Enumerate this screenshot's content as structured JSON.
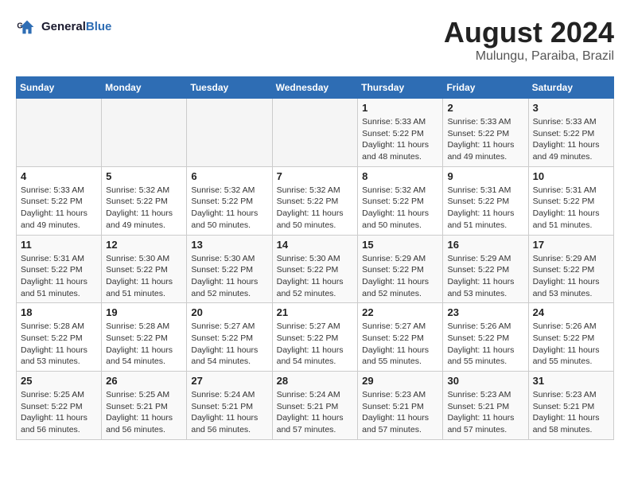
{
  "header": {
    "logo_line1": "General",
    "logo_line2": "Blue",
    "month_year": "August 2024",
    "location": "Mulungu, Paraiba, Brazil"
  },
  "days_of_week": [
    "Sunday",
    "Monday",
    "Tuesday",
    "Wednesday",
    "Thursday",
    "Friday",
    "Saturday"
  ],
  "weeks": [
    [
      {
        "day": "",
        "info": ""
      },
      {
        "day": "",
        "info": ""
      },
      {
        "day": "",
        "info": ""
      },
      {
        "day": "",
        "info": ""
      },
      {
        "day": "1",
        "info": "Sunrise: 5:33 AM\nSunset: 5:22 PM\nDaylight: 11 hours\nand 48 minutes."
      },
      {
        "day": "2",
        "info": "Sunrise: 5:33 AM\nSunset: 5:22 PM\nDaylight: 11 hours\nand 49 minutes."
      },
      {
        "day": "3",
        "info": "Sunrise: 5:33 AM\nSunset: 5:22 PM\nDaylight: 11 hours\nand 49 minutes."
      }
    ],
    [
      {
        "day": "4",
        "info": "Sunrise: 5:33 AM\nSunset: 5:22 PM\nDaylight: 11 hours\nand 49 minutes."
      },
      {
        "day": "5",
        "info": "Sunrise: 5:32 AM\nSunset: 5:22 PM\nDaylight: 11 hours\nand 49 minutes."
      },
      {
        "day": "6",
        "info": "Sunrise: 5:32 AM\nSunset: 5:22 PM\nDaylight: 11 hours\nand 50 minutes."
      },
      {
        "day": "7",
        "info": "Sunrise: 5:32 AM\nSunset: 5:22 PM\nDaylight: 11 hours\nand 50 minutes."
      },
      {
        "day": "8",
        "info": "Sunrise: 5:32 AM\nSunset: 5:22 PM\nDaylight: 11 hours\nand 50 minutes."
      },
      {
        "day": "9",
        "info": "Sunrise: 5:31 AM\nSunset: 5:22 PM\nDaylight: 11 hours\nand 51 minutes."
      },
      {
        "day": "10",
        "info": "Sunrise: 5:31 AM\nSunset: 5:22 PM\nDaylight: 11 hours\nand 51 minutes."
      }
    ],
    [
      {
        "day": "11",
        "info": "Sunrise: 5:31 AM\nSunset: 5:22 PM\nDaylight: 11 hours\nand 51 minutes."
      },
      {
        "day": "12",
        "info": "Sunrise: 5:30 AM\nSunset: 5:22 PM\nDaylight: 11 hours\nand 51 minutes."
      },
      {
        "day": "13",
        "info": "Sunrise: 5:30 AM\nSunset: 5:22 PM\nDaylight: 11 hours\nand 52 minutes."
      },
      {
        "day": "14",
        "info": "Sunrise: 5:30 AM\nSunset: 5:22 PM\nDaylight: 11 hours\nand 52 minutes."
      },
      {
        "day": "15",
        "info": "Sunrise: 5:29 AM\nSunset: 5:22 PM\nDaylight: 11 hours\nand 52 minutes."
      },
      {
        "day": "16",
        "info": "Sunrise: 5:29 AM\nSunset: 5:22 PM\nDaylight: 11 hours\nand 53 minutes."
      },
      {
        "day": "17",
        "info": "Sunrise: 5:29 AM\nSunset: 5:22 PM\nDaylight: 11 hours\nand 53 minutes."
      }
    ],
    [
      {
        "day": "18",
        "info": "Sunrise: 5:28 AM\nSunset: 5:22 PM\nDaylight: 11 hours\nand 53 minutes."
      },
      {
        "day": "19",
        "info": "Sunrise: 5:28 AM\nSunset: 5:22 PM\nDaylight: 11 hours\nand 54 minutes."
      },
      {
        "day": "20",
        "info": "Sunrise: 5:27 AM\nSunset: 5:22 PM\nDaylight: 11 hours\nand 54 minutes."
      },
      {
        "day": "21",
        "info": "Sunrise: 5:27 AM\nSunset: 5:22 PM\nDaylight: 11 hours\nand 54 minutes."
      },
      {
        "day": "22",
        "info": "Sunrise: 5:27 AM\nSunset: 5:22 PM\nDaylight: 11 hours\nand 55 minutes."
      },
      {
        "day": "23",
        "info": "Sunrise: 5:26 AM\nSunset: 5:22 PM\nDaylight: 11 hours\nand 55 minutes."
      },
      {
        "day": "24",
        "info": "Sunrise: 5:26 AM\nSunset: 5:22 PM\nDaylight: 11 hours\nand 55 minutes."
      }
    ],
    [
      {
        "day": "25",
        "info": "Sunrise: 5:25 AM\nSunset: 5:22 PM\nDaylight: 11 hours\nand 56 minutes."
      },
      {
        "day": "26",
        "info": "Sunrise: 5:25 AM\nSunset: 5:21 PM\nDaylight: 11 hours\nand 56 minutes."
      },
      {
        "day": "27",
        "info": "Sunrise: 5:24 AM\nSunset: 5:21 PM\nDaylight: 11 hours\nand 56 minutes."
      },
      {
        "day": "28",
        "info": "Sunrise: 5:24 AM\nSunset: 5:21 PM\nDaylight: 11 hours\nand 57 minutes."
      },
      {
        "day": "29",
        "info": "Sunrise: 5:23 AM\nSunset: 5:21 PM\nDaylight: 11 hours\nand 57 minutes."
      },
      {
        "day": "30",
        "info": "Sunrise: 5:23 AM\nSunset: 5:21 PM\nDaylight: 11 hours\nand 57 minutes."
      },
      {
        "day": "31",
        "info": "Sunrise: 5:23 AM\nSunset: 5:21 PM\nDaylight: 11 hours\nand 58 minutes."
      }
    ]
  ]
}
